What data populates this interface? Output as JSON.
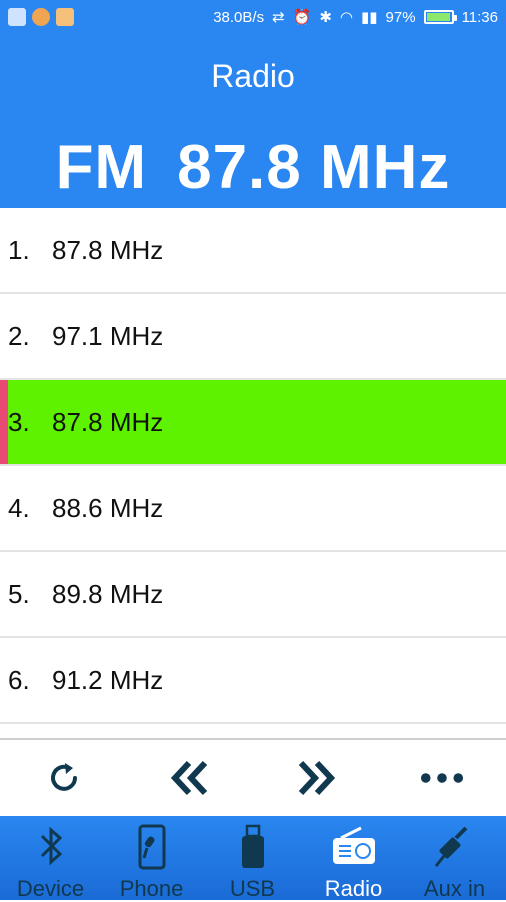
{
  "status_bar": {
    "speed": "38.0B/s",
    "battery": "97%",
    "time": "11:36"
  },
  "header": {
    "title": "Radio",
    "band": "FM",
    "frequency": "87.8 MHz"
  },
  "presets": [
    {
      "num": "1.",
      "freq": "87.8 MHz"
    },
    {
      "num": "2.",
      "freq": "97.1 MHz"
    },
    {
      "num": "3.",
      "freq": "87.8 MHz"
    },
    {
      "num": "4.",
      "freq": "88.6 MHz"
    },
    {
      "num": "5.",
      "freq": "89.8 MHz"
    },
    {
      "num": "6.",
      "freq": "91.2 MHz"
    }
  ],
  "active_preset_index": 2,
  "controls": {
    "icons": [
      "refresh-icon",
      "seek-back-icon",
      "seek-forward-icon",
      "more-icon"
    ]
  },
  "tabs": [
    {
      "label": "Device",
      "icon": "bluetooth-icon"
    },
    {
      "label": "Phone",
      "icon": "phone-mic-icon"
    },
    {
      "label": "USB",
      "icon": "usb-icon"
    },
    {
      "label": "Radio",
      "icon": "radio-icon"
    },
    {
      "label": "Aux in",
      "icon": "aux-cable-icon"
    }
  ],
  "active_tab_index": 3,
  "colors": {
    "primary": "#2a86f0",
    "active_row": "#5ef200",
    "active_marker": "#e84a74",
    "icon_dark": "#10384f"
  }
}
